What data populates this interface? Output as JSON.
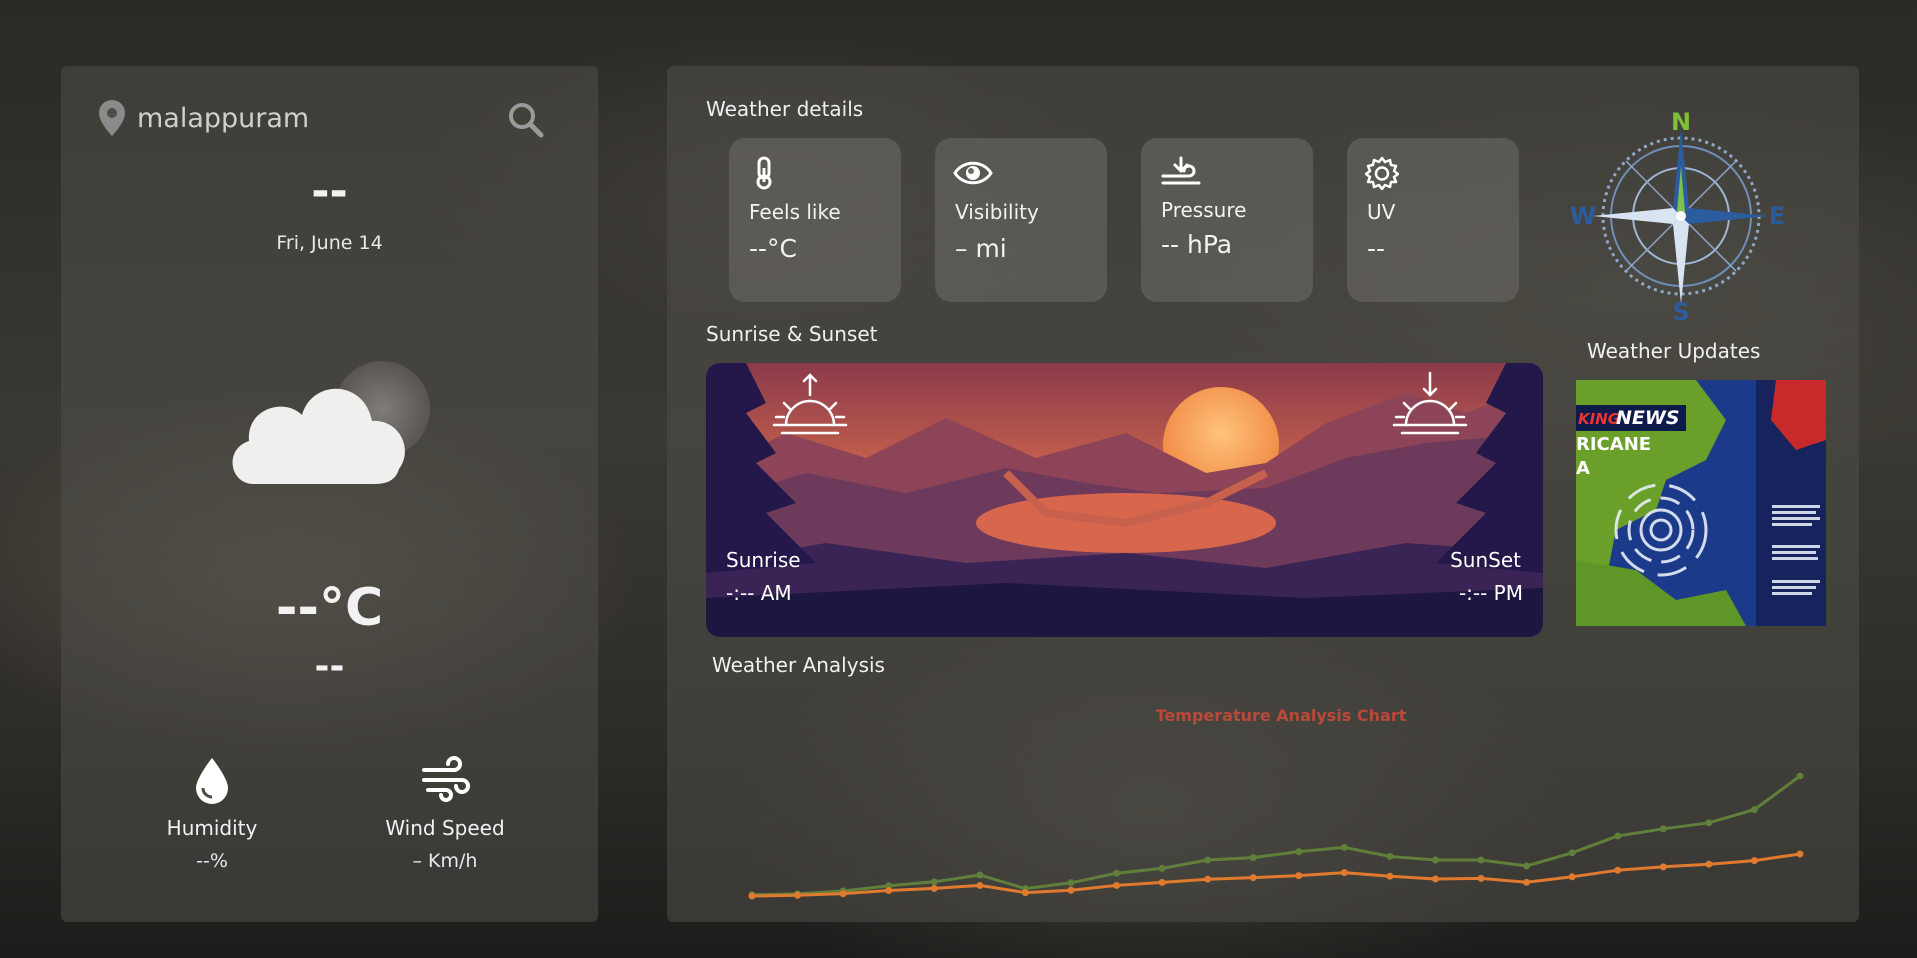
{
  "left": {
    "location": "malappuram",
    "city_placeholder": "--",
    "date": "Fri, June 14",
    "weather_icon": "cloudy-night-icon",
    "temperature": "--°C",
    "description": "--",
    "humidity": {
      "label": "Humidity",
      "value": "--%"
    },
    "wind": {
      "label": "Wind Speed",
      "value": "– Km/h"
    }
  },
  "right": {
    "details_title": "Weather details",
    "cards": [
      {
        "icon": "thermometer-icon",
        "label": "Feels like",
        "value": "--°C"
      },
      {
        "icon": "eye-icon",
        "label": "Visibility",
        "value": "– mi"
      },
      {
        "icon": "pressure-icon",
        "label": "Pressure",
        "value": "-- hPa"
      },
      {
        "icon": "gear-icon",
        "label": "UV",
        "value": "--"
      }
    ],
    "compass": {
      "n": "N",
      "e": "E",
      "s": "S",
      "w": "W"
    },
    "sun_title": "Sunrise & Sunset",
    "sunrise_label": "Sunrise",
    "sunrise_time": "-:-- AM",
    "sunset_label": "SunSet",
    "sunset_time": "-:-- PM",
    "updates_title": "Weather Updates",
    "news": {
      "line1": "KING",
      "line2": "NEWS",
      "line3": "RICANE",
      "line4": "A"
    },
    "analysis_title": "Weather Analysis"
  },
  "colors": {
    "accent_green": "#6aa43a",
    "series_green": "#5f7f3a",
    "series_orange": "#e07a2e",
    "chart_title": "#b84a3a"
  },
  "chart_data": {
    "type": "line",
    "title": "Temperature Analysis Chart",
    "xlabel": "",
    "ylabel": "",
    "x": [
      1,
      2,
      3,
      4,
      5,
      6,
      7,
      8,
      9,
      10,
      11,
      12,
      13,
      14,
      15,
      16,
      17,
      18,
      19,
      20,
      21,
      22,
      23,
      24
    ],
    "series": [
      {
        "values": [
          1.0,
          1.8,
          4.2,
          8.5,
          11.8,
          17.5,
          6.2,
          11.0,
          19.0,
          23.0,
          30.0,
          32.0,
          37.0,
          40.5,
          33.0,
          30.0,
          30.0,
          25.0,
          36.0,
          50.0,
          56.0,
          61.0,
          72.0,
          100.0
        ]
      },
      {
        "values": [
          0.0,
          0.6,
          2.0,
          4.6,
          6.3,
          8.8,
          2.8,
          4.8,
          8.8,
          11.3,
          14.0,
          15.3,
          17.0,
          19.5,
          16.5,
          14.2,
          14.7,
          11.4,
          16.0,
          21.5,
          24.3,
          26.5,
          29.5,
          35.0
        ]
      }
    ],
    "grid": false,
    "legend": "none"
  }
}
